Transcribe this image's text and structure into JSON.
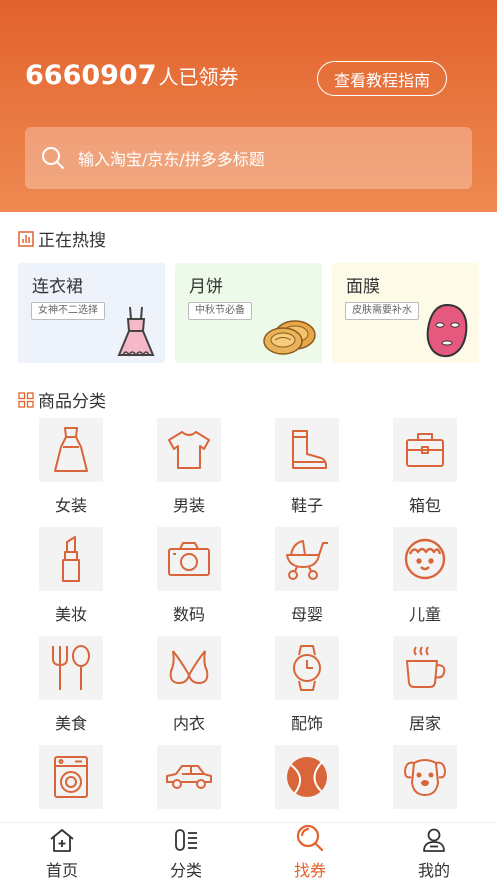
{
  "header": {
    "count": "6660907",
    "count_suffix": "人已领券",
    "guide_button": "查看教程指南",
    "search_placeholder": "输入淘宝/京东/拼多多标题"
  },
  "hot": {
    "title": "正在热搜",
    "cards": [
      {
        "name": "连衣裙",
        "tag": "女神不二选择",
        "bg": "#eef2fb"
      },
      {
        "name": "月饼",
        "tag": "中秋节必备",
        "bg": "#eefae9"
      },
      {
        "name": "面膜",
        "tag": "皮肤需要补水",
        "bg": "#fdfbe8"
      }
    ]
  },
  "categories": {
    "title": "商品分类",
    "items": [
      {
        "label": "女装",
        "icon": "dress-icon"
      },
      {
        "label": "男装",
        "icon": "tshirt-icon"
      },
      {
        "label": "鞋子",
        "icon": "boot-icon"
      },
      {
        "label": "箱包",
        "icon": "bag-icon"
      },
      {
        "label": "美妆",
        "icon": "lipstick-icon"
      },
      {
        "label": "数码",
        "icon": "camera-icon"
      },
      {
        "label": "母婴",
        "icon": "stroller-icon"
      },
      {
        "label": "儿童",
        "icon": "child-face-icon"
      },
      {
        "label": "美食",
        "icon": "fork-spoon-icon"
      },
      {
        "label": "内衣",
        "icon": "bra-icon"
      },
      {
        "label": "配饰",
        "icon": "watch-icon"
      },
      {
        "label": "居家",
        "icon": "cup-icon"
      },
      {
        "label": "",
        "icon": "washing-machine-icon"
      },
      {
        "label": "",
        "icon": "car-icon"
      },
      {
        "label": "",
        "icon": "ball-icon"
      },
      {
        "label": "",
        "icon": "dog-icon"
      }
    ]
  },
  "tabbar": {
    "items": [
      {
        "label": "首页",
        "icon": "home-icon"
      },
      {
        "label": "分类",
        "icon": "category-icon"
      },
      {
        "label": "找券",
        "icon": "search-coupon-icon"
      },
      {
        "label": "我的",
        "icon": "user-icon"
      }
    ]
  },
  "colors": {
    "accent": "#e2622d",
    "icon_stroke": "#d9663a"
  }
}
